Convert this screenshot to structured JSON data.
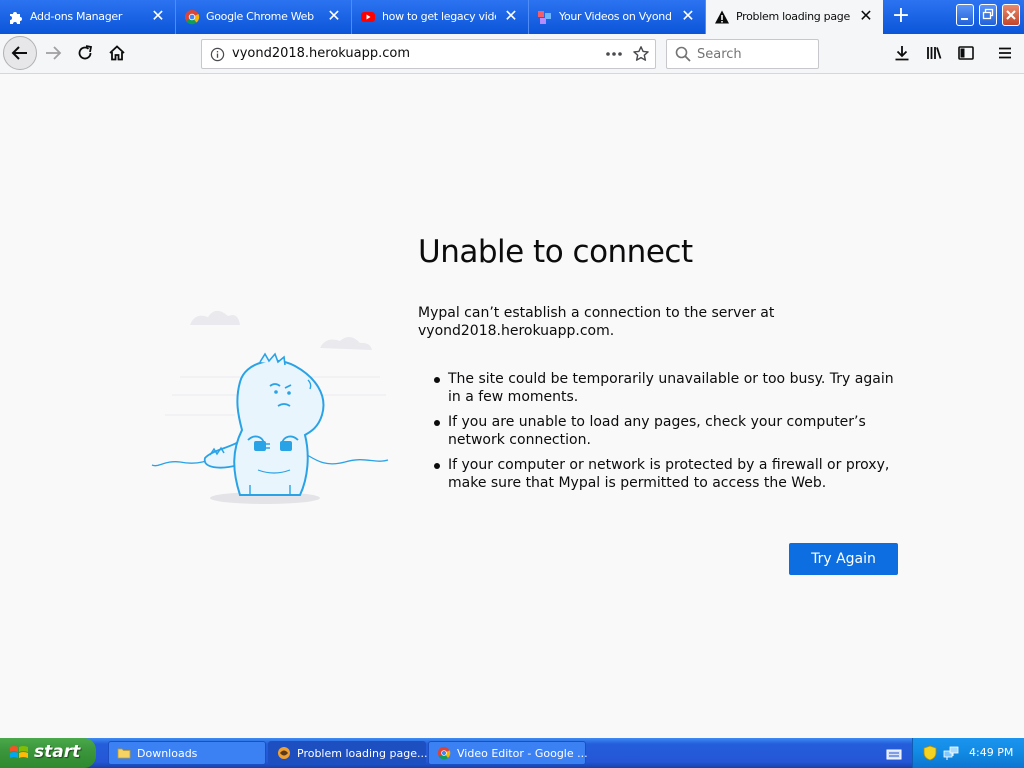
{
  "browser": {
    "tabs": [
      {
        "label": "Add-ons Manager",
        "icon": "puzzle-icon"
      },
      {
        "label": "Google Chrome Web Bro",
        "icon": "chrome-icon"
      },
      {
        "label": "how to get legacy video",
        "icon": "youtube-icon"
      },
      {
        "label": "Your Videos on Vyond Le",
        "icon": "vyond-icon"
      },
      {
        "label": "Problem loading page",
        "icon": "warning-icon",
        "active": true
      }
    ],
    "new_tab_symbol": "+",
    "close_symbol": "✕",
    "url": "vyond2018.herokuapp.com",
    "search_placeholder": "Search"
  },
  "error_page": {
    "title": "Unable to connect",
    "description": "Mypal can’t establish a connection to the server at vyond2018.herokuapp.com.",
    "bullets": [
      "The site could be temporarily unavailable or too busy. Try again in a few moments.",
      "If you are unable to load any pages, check your computer’s network connection.",
      "If your computer or network is protected by a firewall or proxy, make sure that Mypal is permitted to access the Web."
    ],
    "button_label": "Try Again"
  },
  "taskbar": {
    "start_label": "start",
    "tasks": [
      {
        "label": "Downloads",
        "icon": "folder-icon"
      },
      {
        "label": "Problem loading page...",
        "icon": "mypal-icon",
        "active": true
      },
      {
        "label": "Video Editor - Google ...",
        "icon": "chrome-icon"
      }
    ],
    "clock": "4:49 PM"
  },
  "colors": {
    "tabstrip": "#0b55d9",
    "accent_button": "#0c6ee0",
    "page_background": "#f9f9fa"
  }
}
